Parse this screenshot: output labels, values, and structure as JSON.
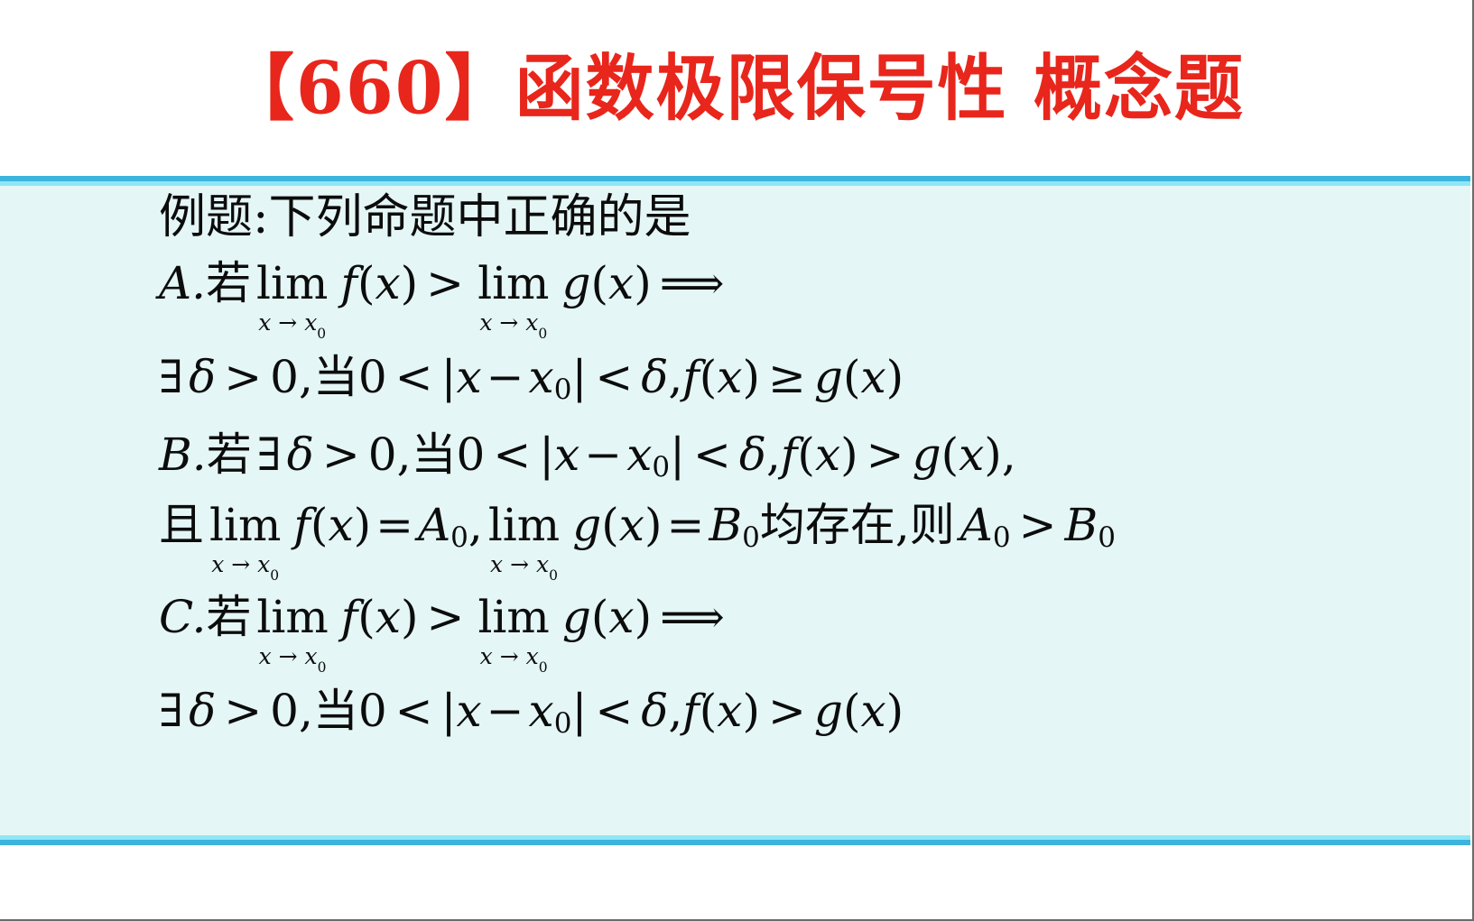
{
  "slide": {
    "title": "【660】函数极限保号性 概念题",
    "title_color": "#e8261c",
    "panel_bg": "#e4f6f5",
    "panel_border_color": "#3cb4de",
    "panel_inner_line_color": "#8fe7f5"
  },
  "content": {
    "prompt": "例题:下列命题中正确的是",
    "options": [
      {
        "key": "A.",
        "lines": [
          {
            "parts": [
              {
                "t": "label",
                "v": "A."
              },
              {
                "t": "han",
                "v": "若"
              },
              {
                "t": "lim",
                "v": "lim",
                "sub": "x → x₀"
              },
              {
                "t": "it",
                "v": "f"
              },
              {
                "t": "rm",
                "v": "("
              },
              {
                "t": "it",
                "v": "x"
              },
              {
                "t": "rm",
                "v": ")"
              },
              {
                "t": "op",
                "v": ">"
              },
              {
                "t": "lim",
                "v": "lim",
                "sub": "x → x₀"
              },
              {
                "t": "it",
                "v": "g"
              },
              {
                "t": "rm",
                "v": "("
              },
              {
                "t": "it",
                "v": "x"
              },
              {
                "t": "rm",
                "v": ")"
              },
              {
                "t": "op",
                "v": "⟹"
              }
            ],
            "plain": "A.若 lim(x→x₀) f(x) > lim(x→x₀) g(x) ⟹"
          },
          {
            "plain": "∃δ > 0, 当0 < |x − x₀| < δ, f(x) ≥ g(x)"
          }
        ]
      },
      {
        "key": "B.",
        "lines": [
          {
            "plain": "B.若 ∃δ > 0, 当0 < |x − x₀| < δ, f(x) > g(x),"
          },
          {
            "plain": "且 lim(x→x₀) f(x) = A₀, lim(x→x₀) g(x) = B₀均存在, 则 A₀ > B₀"
          }
        ]
      },
      {
        "key": "C.",
        "lines": [
          {
            "plain": "C.若 lim(x→x₀) f(x) > lim(x→x₀) g(x) ⟹"
          },
          {
            "plain": "∃δ > 0, 当0 < |x − x₀| < δ, f(x) > g(x)"
          }
        ]
      }
    ],
    "tokens": {
      "label_a": "A.",
      "label_b": "B.",
      "label_c": "C.",
      "ruo": "若",
      "dang": "当",
      "qie": "且",
      "junzaicun": "均存在",
      "ze": "则",
      "lim": "lim",
      "lim_sub": "x → x",
      "lim_sub_zero": "0",
      "f": "f",
      "g": "g",
      "x": "x",
      "zero": "0",
      "delta": "δ",
      "exists": "∃",
      "gt": ">",
      "lt": "<",
      "ge": "≥",
      "implies": "⟹",
      "eq": "=",
      "minus": "−",
      "comma": ",",
      "lparen": "(",
      "rparen": ")",
      "bar": "|",
      "A": "A",
      "B": "B",
      "sub0": "0"
    }
  }
}
